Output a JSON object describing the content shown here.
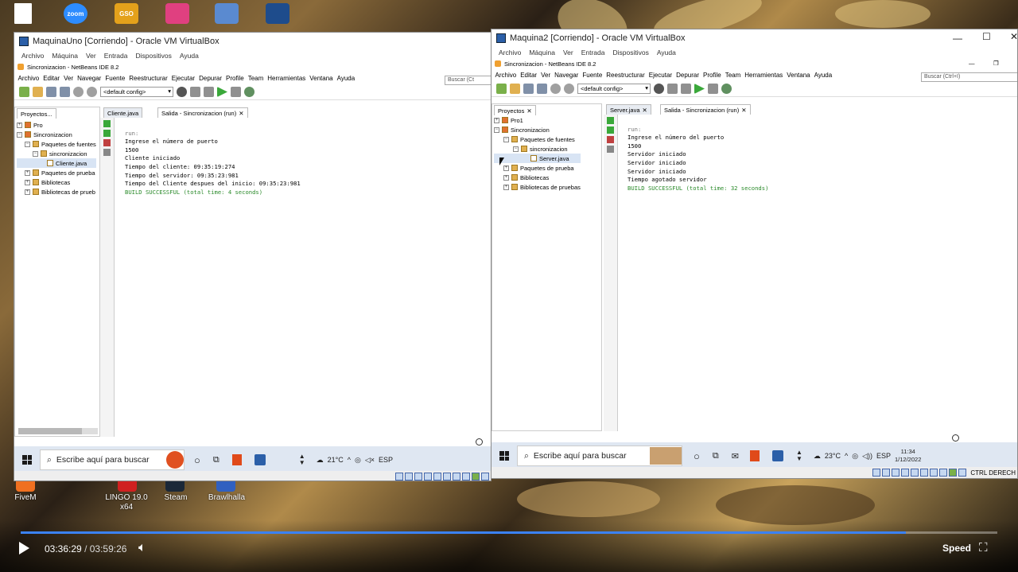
{
  "desktop": {
    "top_icons": [
      {
        "name": "file-icon",
        "color": "#ffffff"
      },
      {
        "name": "zoom-icon",
        "label": "zoom",
        "color": "#2d8cff"
      },
      {
        "name": "gso-icon",
        "label": "GSO",
        "color": "#e4a11b"
      },
      {
        "name": "app-icon",
        "color": "#e04080"
      },
      {
        "name": "tool-icon",
        "color": "#5a8ad0"
      },
      {
        "name": "virtualbox-icon",
        "color": "#1e4c8c"
      }
    ],
    "bottom_icons": [
      {
        "label": "FiveM",
        "color": "#f07020"
      },
      {
        "label": "LINGO 19.0 x64",
        "color": "#d02020"
      },
      {
        "label": "Steam",
        "color": "#1b2838"
      },
      {
        "label": "Brawlhalla",
        "color": "#3060c0"
      }
    ]
  },
  "win1": {
    "title": "MaquinaUno [Corriendo] - Oracle VM VirtualBox",
    "vb_menu": [
      "Archivo",
      "Máquina",
      "Ver",
      "Entrada",
      "Dispositivos",
      "Ayuda"
    ],
    "nb_title": "Sincronizacion - NetBeans IDE 8.2",
    "nb_menu": [
      "Archivo",
      "Editar",
      "Ver",
      "Navegar",
      "Fuente",
      "Reestructurar",
      "Ejecutar",
      "Depurar",
      "Profile",
      "Team",
      "Herramientas",
      "Ventana",
      "Ayuda"
    ],
    "search": "Buscar (Ct",
    "config": "<default config>",
    "projects_tab": "Proyectos...",
    "tree": [
      "Pro",
      "Sincronizacion",
      "Paquetes de fuentes",
      "sincronizacion",
      "Cliente.java",
      "Paquetes de prueba",
      "Bibliotecas",
      "Bibliotecas de prueb"
    ],
    "editor_tabs": [
      "Cliente.java",
      "Salida - Sincronizacion (run)"
    ],
    "console": [
      "run:",
      "Ingrese el número de puerto",
      "1500",
      "Cliente iniciado",
      "",
      "Tiempo del cliente: 09:35:19:274",
      "Tiempo del servidor: 09:35:23:981",
      "Tiempo del Cliente despues del inicio: 09:35:23:981",
      "BUILD SUCCESSFUL (total time: 4 seconds)"
    ],
    "taskbar": {
      "search": "Escribe aquí para buscar",
      "temp": "21°C",
      "lang": "ESP"
    }
  },
  "win2": {
    "title": "Maquina2 [Corriendo] - Oracle VM VirtualBox",
    "vb_menu": [
      "Archivo",
      "Máquina",
      "Ver",
      "Entrada",
      "Dispositivos",
      "Ayuda"
    ],
    "nb_title": "Sincronizacion - NetBeans IDE 8.2",
    "nb_menu": [
      "Archivo",
      "Editar",
      "Ver",
      "Navegar",
      "Fuente",
      "Reestructurar",
      "Ejecutar",
      "Depurar",
      "Profile",
      "Team",
      "Herramientas",
      "Ventana",
      "Ayuda"
    ],
    "search": "Buscar (Ctrl+I)",
    "config": "<default config>",
    "projects_tab": "Proyectos",
    "tree": [
      "Pro1",
      "Sincronizacion",
      "Paquetes de fuentes",
      "sincronizacion",
      "Server.java",
      "Paquetes de prueba",
      "Bibliotecas",
      "Bibliotecas de pruebas"
    ],
    "editor_tabs": [
      "Server.java",
      "Salida - Sincronizacion (run)"
    ],
    "console": [
      "run:",
      "Ingrese el número del puerto",
      "1500",
      "Servidor iniciado",
      "Servidor iniciado",
      "Servidor iniciado",
      "Tiempo agotado servidor",
      "BUILD SUCCESSFUL (total time: 32 seconds)"
    ],
    "taskbar": {
      "search": "Escribe aquí para buscar",
      "temp": "23°C",
      "lang": "ESP",
      "time": "11:34",
      "date": "1/12/2022"
    },
    "host_key": "CTRL DERECH"
  },
  "player": {
    "current": "03:36:29",
    "separator": "/",
    "total": "03:59:26",
    "speed_label": "Speed",
    "progress": 0.906,
    "accent": "#3b82f6"
  }
}
